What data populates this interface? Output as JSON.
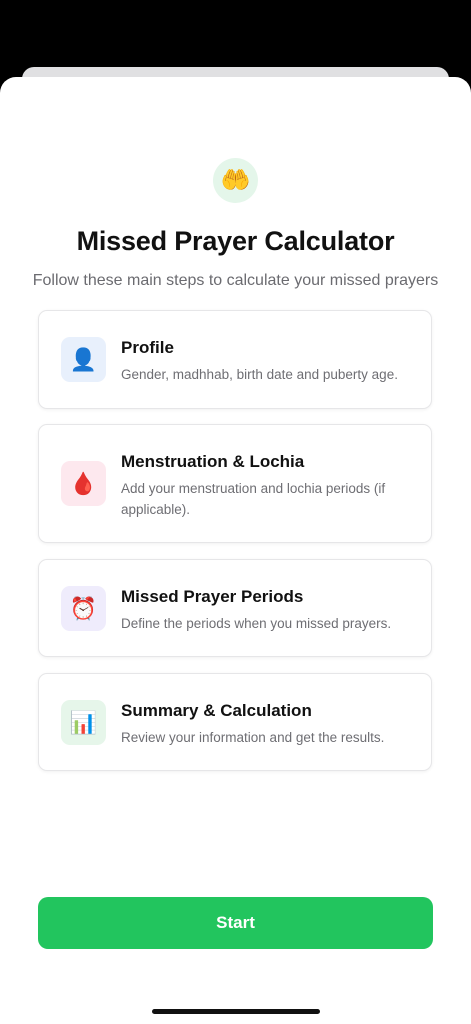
{
  "hero": {
    "icon": "🤲",
    "icon_name": "praying-hands-icon",
    "title": "Missed Prayer Calculator",
    "subtitle": "Follow these main steps to calculate your missed prayers"
  },
  "steps": [
    {
      "icon": "👤",
      "icon_name": "person-icon",
      "icon_bg": "#e8f0fc",
      "title": "Profile",
      "description": "Gender, madhhab, birth date and puberty age."
    },
    {
      "icon": "🩸",
      "icon_name": "blood-drop-icon",
      "icon_bg": "#fde8ee",
      "title": "Menstruation & Lochia",
      "description": "Add your menstruation and lochia periods (if applicable)."
    },
    {
      "icon": "⏰",
      "icon_name": "alarm-clock-icon",
      "icon_bg": "#efecfc",
      "title": "Missed Prayer Periods",
      "description": "Define the periods when you missed prayers."
    },
    {
      "icon": "📊",
      "icon_name": "bar-chart-icon",
      "icon_bg": "#e6f6ea",
      "title": "Summary & Calculation",
      "description": "Review your information and get the results."
    }
  ],
  "actions": {
    "start_label": "Start"
  },
  "colors": {
    "accent": "#22c55e",
    "hero_badge_bg": "#e4f6ea"
  }
}
